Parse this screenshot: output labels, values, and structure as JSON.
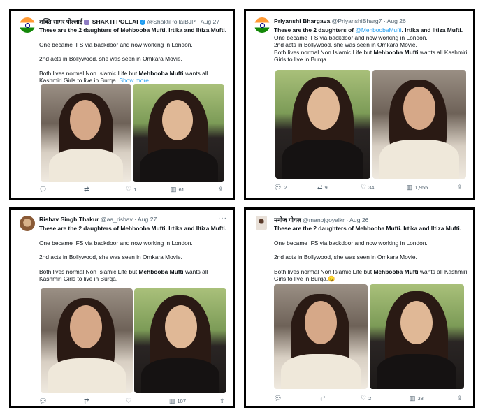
{
  "tweets": [
    {
      "name": "शक्ति सागर पोल्लाई",
      "name2": "SHAKTI POLLAI",
      "handle": "@ShaktiPollaiBJP",
      "date": "· Aug 27",
      "text": {
        "line1_pre": "These are the 2 daughters of Mehbooba Mufti. Irtika and Iltiza Mufti.",
        "line2": "One became IFS via backdoor and now working in London.",
        "line3": "2nd acts in Bollywood, she was seen in Omkara Movie.",
        "line4_a": "Both lives normal Non Islamic Life but ",
        "line4_b": "Mehbooba Mufti",
        "line4_c": " wants all Kashmiri Girls to live in Burqa.",
        "show_more": " Show more"
      },
      "counts": {
        "reply": "",
        "retweet": "",
        "like": "1",
        "views": "61"
      }
    },
    {
      "name": "Priyanshi Bhargava",
      "handle": "@PriyanshiBharg7",
      "date": "· Aug 26",
      "text": {
        "line1_pre": "These are the 2 daughters of ",
        "line1_link": "@MehboobaMufti",
        "line1_post": ". Irtika and Iltiza Mufti.",
        "line2": "One became IFS via backdoor and now working in London.",
        "line3": "2nd acts in Bollywood, she was seen in Omkara Movie.",
        "line4_a": "Both lives normal Non Islamic Life but ",
        "line4_b": "Mehbooba Mufti",
        "line4_c": " wants all Kashmiri Girls to live in Burqa."
      },
      "counts": {
        "reply": "2",
        "retweet": "9",
        "like": "34",
        "views": "1,955"
      }
    },
    {
      "name": "Rishav Singh Thakur",
      "handle": "@aa_rishav",
      "date": "· Aug 27",
      "text": {
        "line1_pre": "These are the 2 daughters of Mehbooba Mufti. Irtika and Iltiza Mufti.",
        "line2": "One became IFS via backdoor and now working in London.",
        "line3": "2nd acts in Bollywood, she was seen in Omkara Movie.",
        "line4_a": "Both lives normal Non Islamic Life but ",
        "line4_b": "Mehbooba Mufti",
        "line4_c": " wants all Kashmiri Girls to live in Burqa."
      },
      "counts": {
        "reply": "",
        "retweet": "",
        "like": "",
        "views": "107"
      }
    },
    {
      "name": "मनोज गोयल",
      "handle": "@manojgoyalkr",
      "date": "· Aug 26",
      "text": {
        "line1_pre": "These are the 2 daughters of Mehbooba Mufti. Irtika and Iltiza Mufti.",
        "line2": "One became IFS via backdoor and now working in London.",
        "line3": "2nd acts in Bollywood, she was seen in Omkara Movie.",
        "line4_a": "Both lives normal Non Islamic Life but ",
        "line4_b": "Mehbooba Mufti",
        "line4_c": " wants all Kashmiri Girls to live in Burqa.",
        "emoji": "😠"
      },
      "counts": {
        "reply": "",
        "retweet": "",
        "like": "2",
        "views": "38"
      }
    }
  ],
  "icons": {
    "reply": "reply-icon",
    "retweet": "retweet-icon",
    "like": "like-icon",
    "views": "views-icon",
    "share": "share-icon",
    "more": "more-icon"
  },
  "colors": {
    "link": "#1d9bf0",
    "muted": "#536471",
    "text": "#0f1419"
  }
}
